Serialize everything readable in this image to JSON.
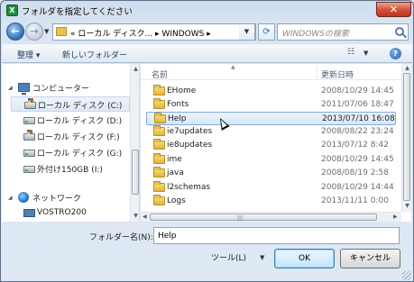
{
  "window": {
    "title": "フォルダを指定してください",
    "close_glyph": "✕"
  },
  "nav": {
    "back_glyph": "←",
    "forward_glyph": "→",
    "address_path": "« ローカル ディスク... ▸ WINDOWS ▸",
    "search_placeholder": "WINDOWSの検索"
  },
  "toolbar": {
    "organize_label": "整理 ▾",
    "new_folder_label": "新しいフォルダー",
    "help_glyph": "?"
  },
  "sidebar": {
    "items": [
      {
        "label": "コンピューター",
        "icon": "computer-icon"
      },
      {
        "label": "ローカル ディスク (C:)",
        "icon": "drive-icon"
      },
      {
        "label": "ローカル ディスク (D:)",
        "icon": "drive-icon"
      },
      {
        "label": "ローカル ディスク (F:)",
        "icon": "drive-icon"
      },
      {
        "label": "ローカル ディスク (G:)",
        "icon": "drive-icon"
      },
      {
        "label": "外付け150GB (I:)",
        "icon": "drive-icon"
      },
      {
        "label": "ネットワーク",
        "icon": "network-icon"
      },
      {
        "label": "VOSTRO200",
        "icon": "pc-icon"
      }
    ]
  },
  "filelist": {
    "col_name": "名前",
    "col_date": "更新日時",
    "rows": [
      {
        "name": "EHome",
        "date": "2008/10/29 14:45"
      },
      {
        "name": "Fonts",
        "date": "2011/07/06 18:47"
      },
      {
        "name": "Help",
        "date": "2013/07/10 16:08"
      },
      {
        "name": "ie7updates",
        "date": "2008/08/22 23:24"
      },
      {
        "name": "ie8updates",
        "date": "2013/07/12 8:42"
      },
      {
        "name": "ime",
        "date": "2008/10/29 14:45"
      },
      {
        "name": "java",
        "date": "2008/08/19 2:58"
      },
      {
        "name": "l2schemas",
        "date": "2008/10/29 14:44"
      },
      {
        "name": "Logs",
        "date": "2013/11/11 0:00"
      }
    ],
    "selected_index": 2
  },
  "footer": {
    "folder_name_label": "フォルダー名(N):",
    "folder_name_value": "Help",
    "tools_label": "ツール(L)",
    "ok_label": "OK",
    "cancel_label": "キャンセル"
  }
}
